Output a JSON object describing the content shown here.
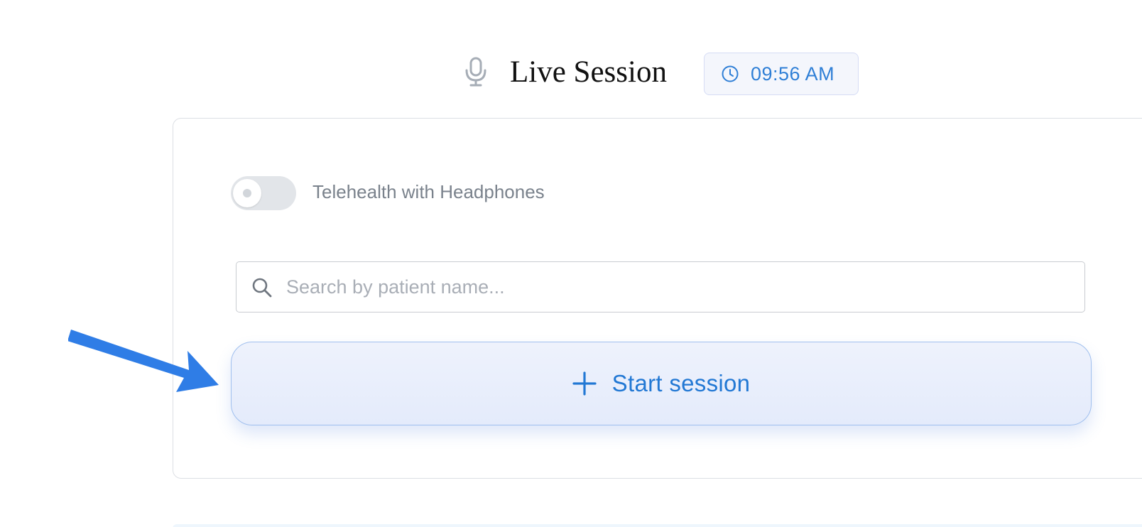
{
  "header": {
    "title": "Live Session",
    "time": "09:56 AM",
    "icons": {
      "mic": "microphone-icon",
      "clock": "clock-icon"
    }
  },
  "toggle": {
    "label": "Telehealth with Headphones",
    "enabled": false
  },
  "search": {
    "placeholder": "Search by patient name...",
    "value": "",
    "icon": "search-icon"
  },
  "start_button": {
    "label": "Start session",
    "icon": "plus-icon"
  },
  "colors": {
    "accent": "#2278d4",
    "annotation_arrow": "#2f7de6",
    "button_border": "#9fbfee",
    "toggle_off": "#e2e5e9"
  }
}
